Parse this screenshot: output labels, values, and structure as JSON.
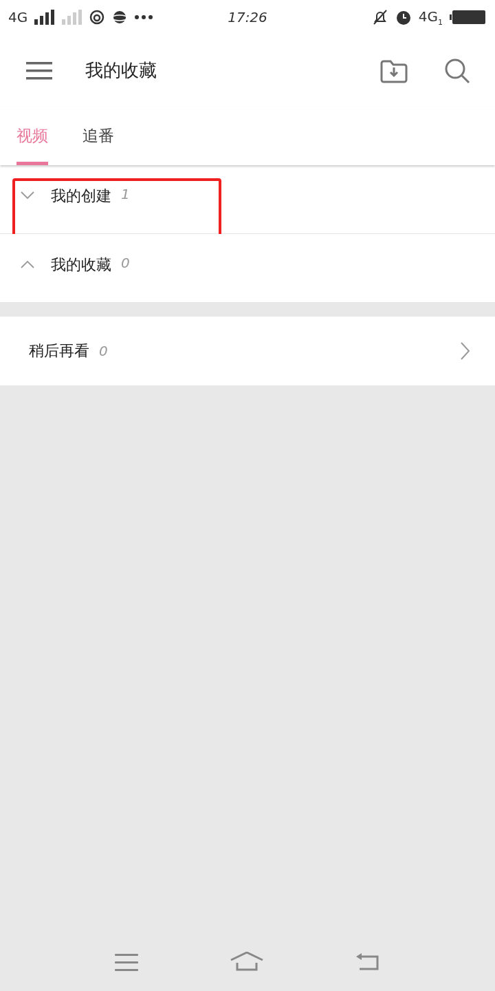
{
  "status_bar": {
    "network_left": "4G",
    "time": "17:26",
    "network_right": "4G",
    "sim_index": "1"
  },
  "app_bar": {
    "title": "我的收藏"
  },
  "tabs": [
    {
      "label": "视频",
      "selected": true
    },
    {
      "label": "追番",
      "selected": false
    }
  ],
  "sections": [
    {
      "title": "我的创建",
      "count": "1",
      "expanded": false,
      "highlighted": true
    },
    {
      "title": "我的收藏",
      "count": "0",
      "expanded": true,
      "highlighted": false
    }
  ],
  "watch_later": {
    "title": "稍后再看",
    "count": "0"
  }
}
